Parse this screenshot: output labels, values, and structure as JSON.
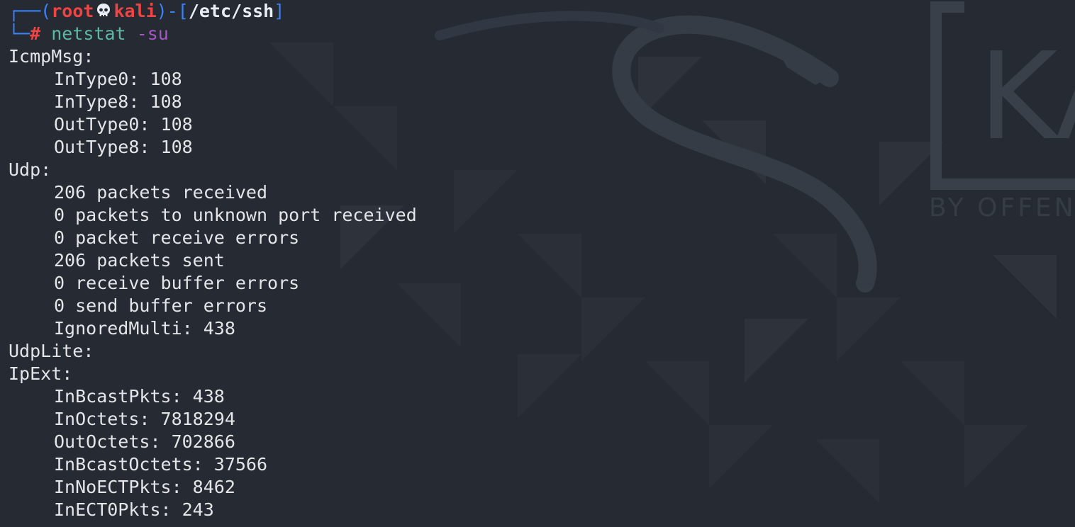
{
  "prompt": {
    "corner_top": "┌──",
    "open_paren": "(",
    "user": "root",
    "skull_icon": "skull-icon",
    "host": "kali",
    "close_paren_dash": ")-[",
    "cwd": "/etc/ssh",
    "close_bracket": "]",
    "corner_bottom": "└─",
    "hash": "#",
    "command": "netstat",
    "flag": "-su"
  },
  "output": {
    "icmpmsg": {
      "header": "IcmpMsg:",
      "lines": [
        "InType0: 108",
        "InType8: 108",
        "OutType0: 108",
        "OutType8: 108"
      ]
    },
    "udp": {
      "header": "Udp:",
      "lines": [
        "206 packets received",
        "0 packets to unknown port received",
        "0 packet receive errors",
        "206 packets sent",
        "0 receive buffer errors",
        "0 send buffer errors",
        "IgnoredMulti: 438"
      ]
    },
    "udplite": {
      "header": "UdpLite:"
    },
    "ipext": {
      "header": "IpExt:",
      "lines": [
        "InBcastPkts: 438",
        "InOctets: 7818294",
        "OutOctets: 702866",
        "InBcastOctets: 37566",
        "InNoECTPkts: 8462",
        "InECT0Pkts: 243"
      ]
    }
  },
  "wallpaper": {
    "watermark_text": "BY OFFEN",
    "logo_letter": "KA"
  },
  "colors": {
    "background": "#262b33",
    "text": "#e3e5e8",
    "prompt_red": "#ef4444",
    "prompt_blue": "#3b82f6",
    "command_teal": "#5cb8a6",
    "flag_purple": "#a855c7"
  }
}
